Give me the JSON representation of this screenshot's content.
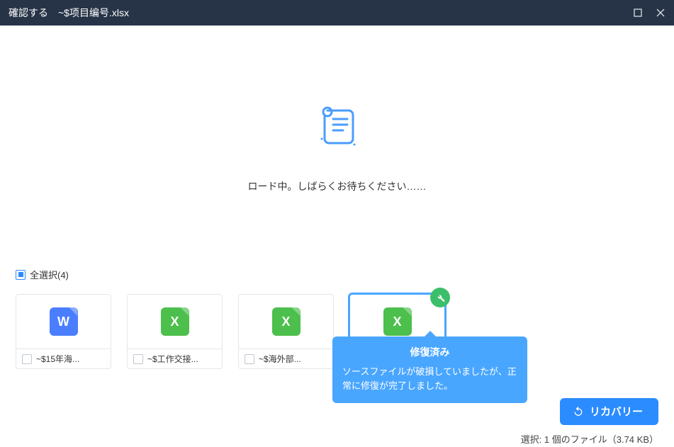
{
  "titlebar": {
    "title": "確認する",
    "filename": "~$项目编号.xlsx"
  },
  "loading": {
    "text": "ロード中。しばらくお待ちください……"
  },
  "selectAll": {
    "label": "全選択(4)"
  },
  "files": [
    {
      "name": "~$15年海...",
      "type": "word",
      "iconLetter": "W",
      "checked": false,
      "repaired": false
    },
    {
      "name": "~$工作交接...",
      "type": "excel",
      "iconLetter": "X",
      "checked": false,
      "repaired": false
    },
    {
      "name": "~$海外部...",
      "type": "excel",
      "iconLetter": "X",
      "checked": false,
      "repaired": false
    },
    {
      "name": "",
      "type": "excel",
      "iconLetter": "X",
      "checked": false,
      "repaired": true,
      "highlight": true
    }
  ],
  "tooltip": {
    "title": "修復済み",
    "body": "ソースファイルが破損していましたが、正常に修復が完了しました。"
  },
  "bottom": {
    "recoverLabel": "リカバリー",
    "status": "選択: 1 個のファイル（3.74 KB）"
  }
}
